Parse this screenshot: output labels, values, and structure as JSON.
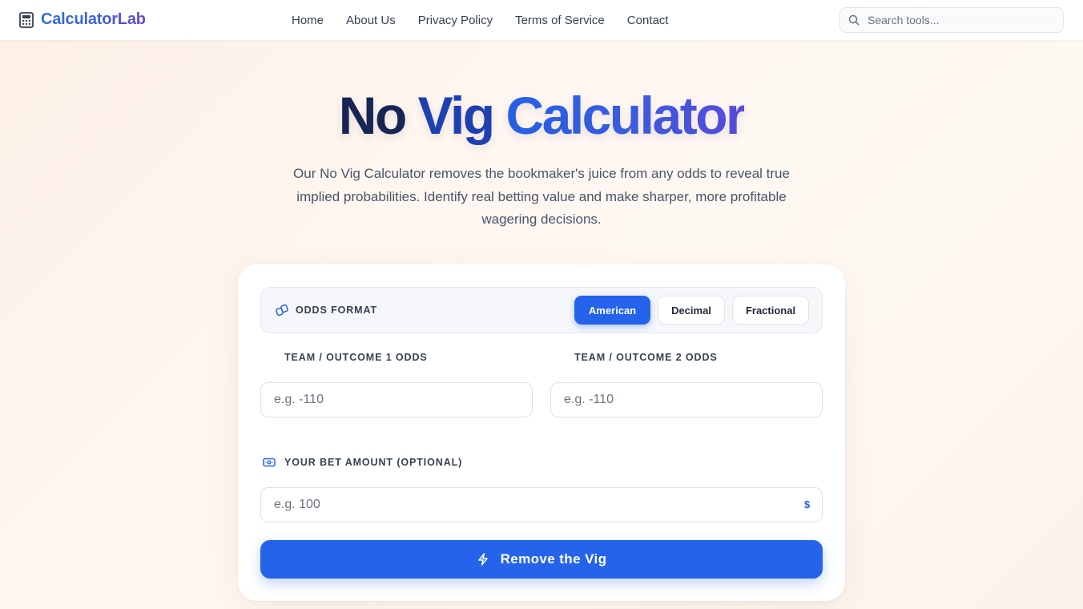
{
  "brand": {
    "name": "CalculatorLab",
    "icon": "calculator-icon"
  },
  "nav": {
    "items": [
      "Home",
      "About Us",
      "Privacy Policy",
      "Terms of Service",
      "Contact"
    ]
  },
  "search": {
    "placeholder": "Search tools...",
    "icon": "search-icon"
  },
  "hero": {
    "title_part1": "No",
    "title_part2": "Vig",
    "title_part3": "Calculator",
    "description": "Our No Vig Calculator removes the bookmaker's juice from any odds to reveal true implied probabilities. Identify real betting value and make sharper, more profitable wagering decisions."
  },
  "calculator": {
    "odds_format": {
      "label": "ODDS FORMAT",
      "icon": "link-icon",
      "options": [
        "American",
        "Decimal",
        "Fractional"
      ],
      "selected": "American"
    },
    "team1": {
      "label": "TEAM / OUTCOME 1 ODDS",
      "value": "",
      "placeholder": "e.g. -110"
    },
    "team2": {
      "label": "TEAM / OUTCOME 2 ODDS",
      "value": "",
      "placeholder": "e.g. -110"
    },
    "bet": {
      "label": "YOUR BET AMOUNT (OPTIONAL)",
      "icon": "cash-icon",
      "value": "",
      "placeholder": "e.g. 100",
      "currency": "$"
    },
    "submit": {
      "label": "Remove the Vig",
      "icon": "lightning-icon"
    }
  },
  "colors": {
    "accent": "#2563eb",
    "title_dark": "#172554",
    "title_mid": "#1e40af",
    "background": "#fef7f1"
  }
}
